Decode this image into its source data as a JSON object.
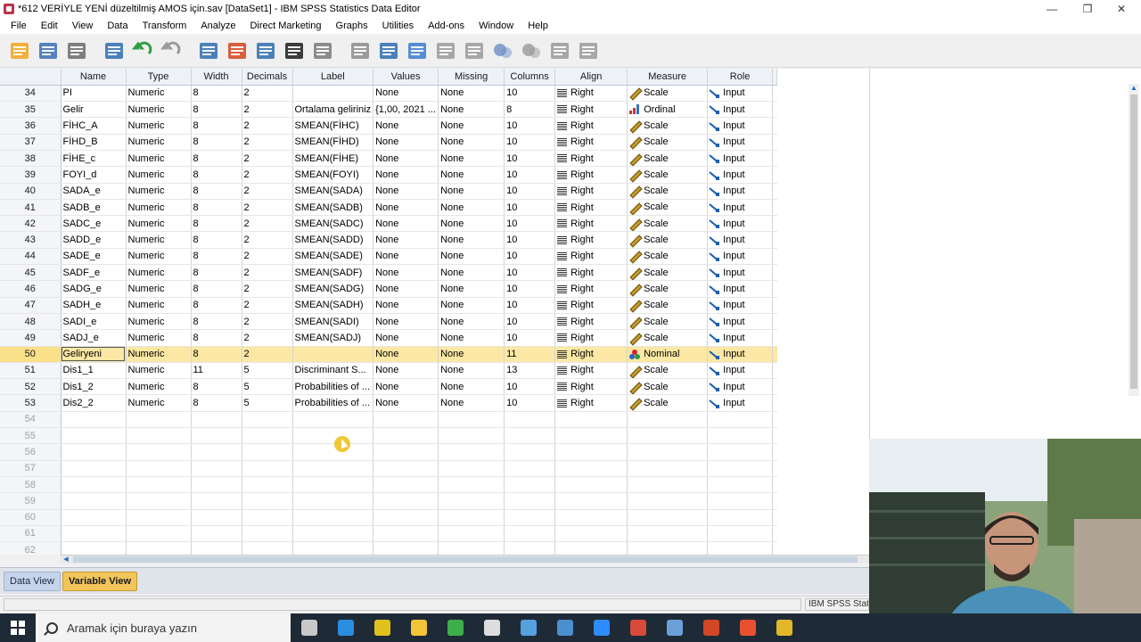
{
  "window": {
    "title": "*612 VERİYLE YENİ düzeltilmiş AMOS için.sav [DataSet1] - IBM SPSS Statistics Data Editor",
    "minimize": "—",
    "restore": "❐",
    "close": "✕"
  },
  "menu": [
    "File",
    "Edit",
    "View",
    "Data",
    "Transform",
    "Analyze",
    "Direct Marketing",
    "Graphs",
    "Utilities",
    "Add-ons",
    "Window",
    "Help"
  ],
  "toolbar": [
    "open-icon",
    "save-icon",
    "print-icon",
    "dialog-recall-icon",
    "undo-icon",
    "redo-icon",
    "goto-case-icon",
    "goto-variable-icon",
    "variables-icon",
    "run-descriptives-icon",
    "find-icon",
    "insert-cases-icon",
    "insert-variable-icon",
    "split-file-icon",
    "weight-cases-icon",
    "select-cases-icon",
    "value-labels-icon",
    "use-sets-icon",
    "show-all-variables-icon",
    "spell-check-icon"
  ],
  "columns": [
    "Name",
    "Type",
    "Width",
    "Decimals",
    "Label",
    "Values",
    "Missing",
    "Columns",
    "Align",
    "Measure",
    "Role"
  ],
  "rows": [
    {
      "n": "34",
      "name": "PI",
      "type": "Numeric",
      "width": "8",
      "dec": "2",
      "label": "",
      "values": "None",
      "missing": "None",
      "cols": "10",
      "align": "Right",
      "measure": "Scale",
      "role": "Input"
    },
    {
      "n": "35",
      "name": "Gelir",
      "type": "Numeric",
      "width": "8",
      "dec": "2",
      "label": "Ortalama geliriniz",
      "values": "{1,00, 2021 ...",
      "missing": "None",
      "cols": "8",
      "align": "Right",
      "measure": "Ordinal",
      "role": "Input"
    },
    {
      "n": "36",
      "name": "FİHC_A",
      "type": "Numeric",
      "width": "8",
      "dec": "2",
      "label": "SMEAN(FİHC)",
      "values": "None",
      "missing": "None",
      "cols": "10",
      "align": "Right",
      "measure": "Scale",
      "role": "Input"
    },
    {
      "n": "37",
      "name": "FİHD_B",
      "type": "Numeric",
      "width": "8",
      "dec": "2",
      "label": "SMEAN(FİHD)",
      "values": "None",
      "missing": "None",
      "cols": "10",
      "align": "Right",
      "measure": "Scale",
      "role": "Input"
    },
    {
      "n": "38",
      "name": "FİHE_c",
      "type": "Numeric",
      "width": "8",
      "dec": "2",
      "label": "SMEAN(FİHE)",
      "values": "None",
      "missing": "None",
      "cols": "10",
      "align": "Right",
      "measure": "Scale",
      "role": "Input"
    },
    {
      "n": "39",
      "name": "FOYI_d",
      "type": "Numeric",
      "width": "8",
      "dec": "2",
      "label": "SMEAN(FOYI)",
      "values": "None",
      "missing": "None",
      "cols": "10",
      "align": "Right",
      "measure": "Scale",
      "role": "Input"
    },
    {
      "n": "40",
      "name": "SADA_e",
      "type": "Numeric",
      "width": "8",
      "dec": "2",
      "label": "SMEAN(SADA)",
      "values": "None",
      "missing": "None",
      "cols": "10",
      "align": "Right",
      "measure": "Scale",
      "role": "Input"
    },
    {
      "n": "41",
      "name": "SADB_e",
      "type": "Numeric",
      "width": "8",
      "dec": "2",
      "label": "SMEAN(SADB)",
      "values": "None",
      "missing": "None",
      "cols": "10",
      "align": "Right",
      "measure": "Scale",
      "role": "Input"
    },
    {
      "n": "42",
      "name": "SADC_e",
      "type": "Numeric",
      "width": "8",
      "dec": "2",
      "label": "SMEAN(SADC)",
      "values": "None",
      "missing": "None",
      "cols": "10",
      "align": "Right",
      "measure": "Scale",
      "role": "Input"
    },
    {
      "n": "43",
      "name": "SADD_e",
      "type": "Numeric",
      "width": "8",
      "dec": "2",
      "label": "SMEAN(SADD)",
      "values": "None",
      "missing": "None",
      "cols": "10",
      "align": "Right",
      "measure": "Scale",
      "role": "Input"
    },
    {
      "n": "44",
      "name": "SADE_e",
      "type": "Numeric",
      "width": "8",
      "dec": "2",
      "label": "SMEAN(SADE)",
      "values": "None",
      "missing": "None",
      "cols": "10",
      "align": "Right",
      "measure": "Scale",
      "role": "Input"
    },
    {
      "n": "45",
      "name": "SADF_e",
      "type": "Numeric",
      "width": "8",
      "dec": "2",
      "label": "SMEAN(SADF)",
      "values": "None",
      "missing": "None",
      "cols": "10",
      "align": "Right",
      "measure": "Scale",
      "role": "Input"
    },
    {
      "n": "46",
      "name": "SADG_e",
      "type": "Numeric",
      "width": "8",
      "dec": "2",
      "label": "SMEAN(SADG)",
      "values": "None",
      "missing": "None",
      "cols": "10",
      "align": "Right",
      "measure": "Scale",
      "role": "Input"
    },
    {
      "n": "47",
      "name": "SADH_e",
      "type": "Numeric",
      "width": "8",
      "dec": "2",
      "label": "SMEAN(SADH)",
      "values": "None",
      "missing": "None",
      "cols": "10",
      "align": "Right",
      "measure": "Scale",
      "role": "Input"
    },
    {
      "n": "48",
      "name": "SADI_e",
      "type": "Numeric",
      "width": "8",
      "dec": "2",
      "label": "SMEAN(SADI)",
      "values": "None",
      "missing": "None",
      "cols": "10",
      "align": "Right",
      "measure": "Scale",
      "role": "Input"
    },
    {
      "n": "49",
      "name": "SADJ_e",
      "type": "Numeric",
      "width": "8",
      "dec": "2",
      "label": "SMEAN(SADJ)",
      "values": "None",
      "missing": "None",
      "cols": "10",
      "align": "Right",
      "measure": "Scale",
      "role": "Input"
    },
    {
      "n": "50",
      "name": "Geliryeni",
      "type": "Numeric",
      "width": "8",
      "dec": "2",
      "label": "",
      "values": "None",
      "missing": "None",
      "cols": "11",
      "align": "Right",
      "measure": "Nominal",
      "role": "Input",
      "selected": true
    },
    {
      "n": "51",
      "name": "Dis1_1",
      "type": "Numeric",
      "width": "11",
      "dec": "5",
      "label": "Discriminant S...",
      "values": "None",
      "missing": "None",
      "cols": "13",
      "align": "Right",
      "measure": "Scale",
      "role": "Input"
    },
    {
      "n": "52",
      "name": "Dis1_2",
      "type": "Numeric",
      "width": "8",
      "dec": "5",
      "label": "Probabilities of ...",
      "values": "None",
      "missing": "None",
      "cols": "10",
      "align": "Right",
      "measure": "Scale",
      "role": "Input"
    },
    {
      "n": "53",
      "name": "Dis2_2",
      "type": "Numeric",
      "width": "8",
      "dec": "5",
      "label": "Probabilities of ...",
      "values": "None",
      "missing": "None",
      "cols": "10",
      "align": "Right",
      "measure": "Scale",
      "role": "Input"
    }
  ],
  "empty_rows": [
    "54",
    "55",
    "56",
    "57",
    "58",
    "59",
    "60",
    "61",
    "62"
  ],
  "tabs": {
    "data_view": "Data View",
    "variable_view": "Variable View"
  },
  "status": {
    "processor": "IBM SPSS Statistics Processor is ready"
  },
  "taskbar": {
    "search_placeholder": "Aramak için buraya yazın"
  },
  "colors": {
    "selected_row": "#fce8a4",
    "active_tab": "#f1c55a",
    "header_bg": "#eef2f8"
  }
}
